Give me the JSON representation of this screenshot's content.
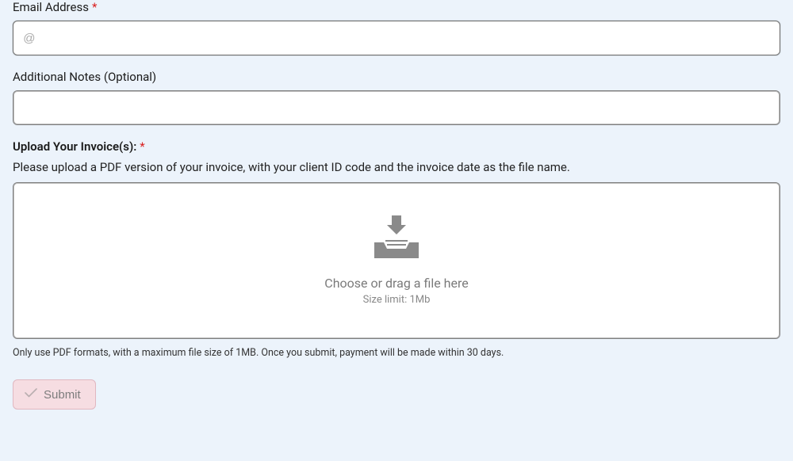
{
  "fields": {
    "email": {
      "label": "Email Address",
      "placeholder": "@",
      "value": ""
    },
    "notes": {
      "label": "Additional Notes (Optional)",
      "value": ""
    },
    "upload": {
      "label": "Upload Your Invoice(s):",
      "help": "Please upload a PDF version of your invoice, with your client ID code and the invoice date as the file name.",
      "prompt": "Choose or drag a file here",
      "limit": "Size limit: 1Mb"
    }
  },
  "footer_note": "Only use PDF formats, with a maximum file size of 1MB. Once you submit, payment will be made within 30 days.",
  "submit": {
    "label": "Submit"
  },
  "required_marker": "*"
}
